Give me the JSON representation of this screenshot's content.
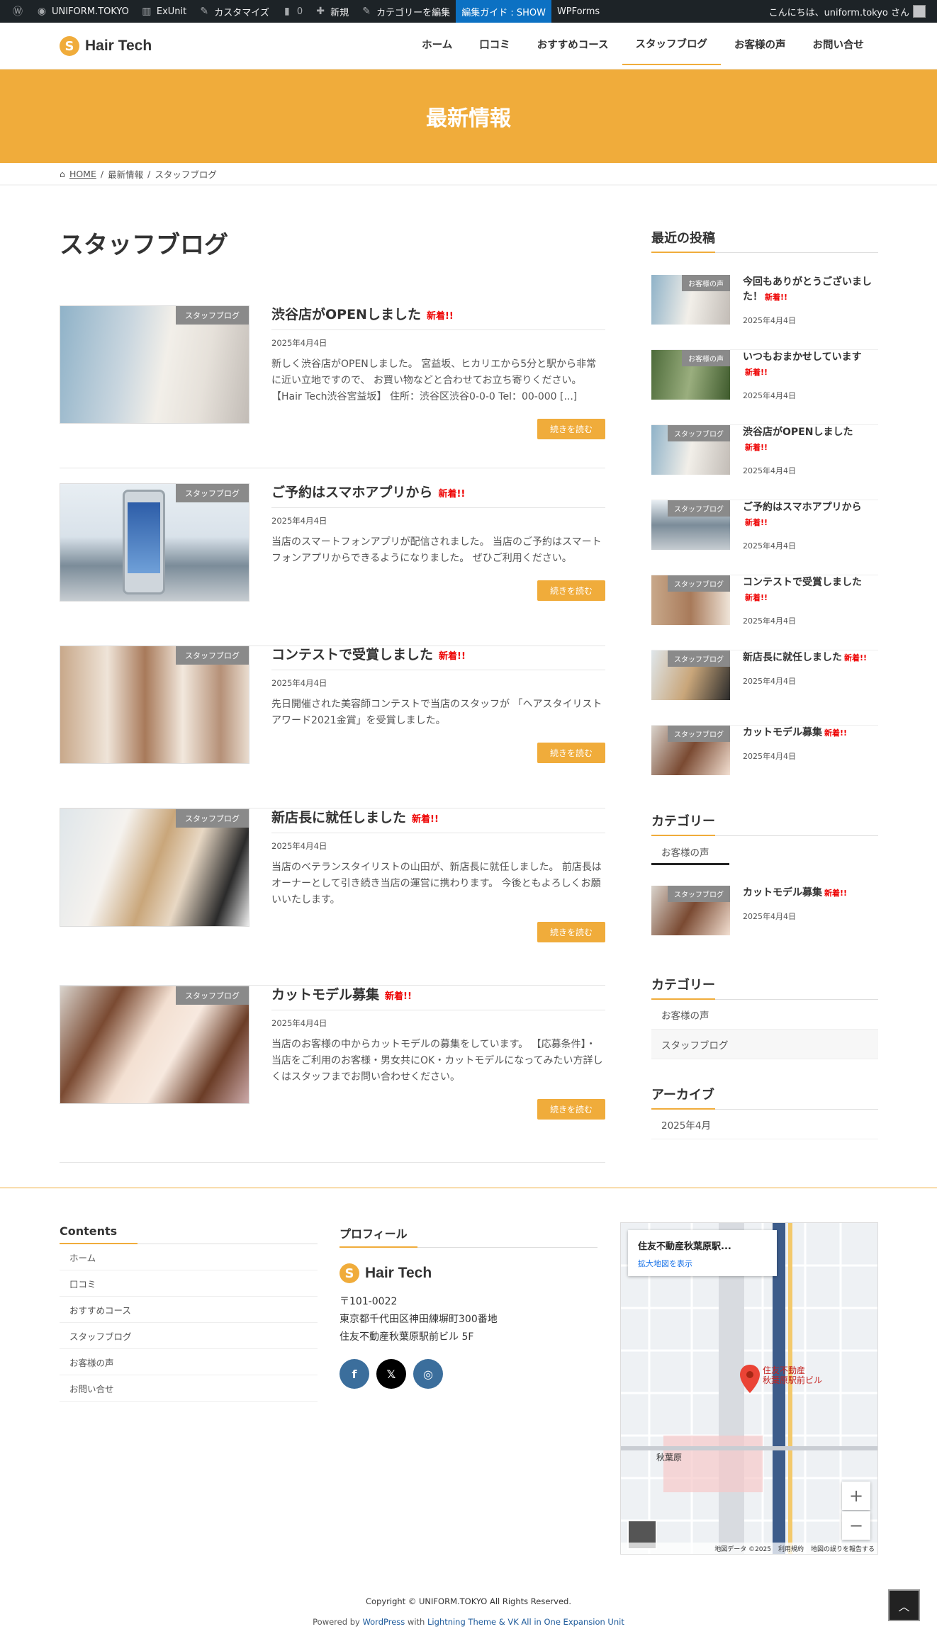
{
  "adminbar": {
    "site": "UNIFORM.TOKYO",
    "exunit": "ExUnit",
    "customize": "カスタマイズ",
    "comments": "0",
    "new": "新規",
    "edit_category": "カテゴリーを編集",
    "guide": "編集ガイド : SHOW",
    "wpforms": "WPForms",
    "greeting": "こんにちは、uniform.tokyo さん"
  },
  "logo": {
    "mark": "S",
    "text": "Hair Tech"
  },
  "nav": [
    "ホーム",
    "口コミ",
    "おすすめコース",
    "スタッフブログ",
    "お客様の声",
    "お問い合せ"
  ],
  "hero": {
    "title": "最新情報"
  },
  "breadcrumb": {
    "home": "HOME",
    "level1": "最新情報",
    "current": "スタッフブログ"
  },
  "page_title": "スタッフブログ",
  "posts": [
    {
      "tag": "スタッフブログ",
      "title": "渋谷店がOPENしました",
      "new": "新着!!",
      "date": "2025年4月4日",
      "excerpt": "新しく渋谷店がOPENしました。 宮益坂、ヒカリエから5分と駅から非常に近い立地ですので、 お買い物などと合わせてお立ち寄りください。 【Hair Tech渋谷宮益坂】 住所：渋谷区渋谷0-0-0 Tel：00-000 [...]",
      "more": "続きを読む"
    },
    {
      "tag": "スタッフブログ",
      "title": "ご予約はスマホアプリから",
      "new": "新着!!",
      "date": "2025年4月4日",
      "excerpt": "当店のスマートフォンアプリが配信されました。 当店のご予約はスマートフォンアプリからできるようになりました。 ぜひご利用ください。",
      "more": "続きを読む"
    },
    {
      "tag": "スタッフブログ",
      "title": "コンテストで受賞しました",
      "new": "新着!!",
      "date": "2025年4月4日",
      "excerpt": "先日開催された美容師コンテストで当店のスタッフが 「ヘアスタイリストアワード2021金賞」を受賞しました。",
      "more": "続きを読む"
    },
    {
      "tag": "スタッフブログ",
      "title": "新店長に就任しました",
      "new": "新着!!",
      "date": "2025年4月4日",
      "excerpt": "当店のベテランスタイリストの山田が、新店長に就任しました。 前店長はオーナーとして引き続き当店の運営に携わります。 今後ともよろしくお願いいたします。",
      "more": "続きを読む"
    },
    {
      "tag": "スタッフブログ",
      "title": "カットモデル募集",
      "new": "新着!!",
      "date": "2025年4月4日",
      "excerpt": "当店のお客様の中からカットモデルの募集をしています。 【応募条件】・当店をご利用のお客様・男女共にOK・カットモデルになってみたい方詳しくはスタッフまでお問い合わせください。",
      "more": "続きを読む"
    }
  ],
  "sidebar": {
    "recent_heading": "最近の投稿",
    "recent": [
      {
        "tag": "お客様の声",
        "title": "今回もありがとうございました！",
        "new": "新着!!",
        "date": "2025年4月4日"
      },
      {
        "tag": "お客様の声",
        "title": "いつもおまかせしています",
        "new": "新着!!",
        "date": "2025年4月4日"
      },
      {
        "tag": "スタッフブログ",
        "title": "渋谷店がOPENしました",
        "new": "新着!!",
        "date": "2025年4月4日"
      },
      {
        "tag": "スタッフブログ",
        "title": "ご予約はスマホアプリから",
        "new": "新着!!",
        "date": "2025年4月4日"
      },
      {
        "tag": "スタッフブログ",
        "title": "コンテストで受賞しました",
        "new": "新着!!",
        "date": "2025年4月4日"
      },
      {
        "tag": "スタッフブログ",
        "title": "新店長に就任しました",
        "new": "新着!!",
        "date": "2025年4月4日"
      },
      {
        "tag": "スタッフブログ",
        "title": "カットモデル募集",
        "new": "新着!!",
        "date": "2025年4月4日"
      }
    ],
    "cat1_heading": "カテゴリー",
    "cat1_item": "お客様の声",
    "cat1_post": {
      "tag": "スタッフブログ",
      "title": "カットモデル募集",
      "new": "新着!!",
      "date": "2025年4月4日"
    },
    "cat2_heading": "カテゴリー",
    "cat2_items": [
      "お客様の声",
      "スタッフブログ"
    ],
    "archive_heading": "アーカイブ",
    "archive_items": [
      "2025年4月"
    ]
  },
  "footer": {
    "contents_heading": "Contents",
    "links": [
      "ホーム",
      "口コミ",
      "おすすめコース",
      "スタッフブログ",
      "お客様の声",
      "お問い合せ"
    ],
    "profile_heading": "プロフィール",
    "profile_logo": "Hair Tech",
    "postal": "〒101-0022",
    "address1": "東京都千代田区神田練塀町300番地",
    "address2": "住友不動産秋葉原駅前ビル 5F",
    "map": {
      "place": "住友不動産秋葉原駅...",
      "enlarge": "拡大地図を表示",
      "pin_label": "住友不動産 秋葉原駅前ビル",
      "station": "秋葉原",
      "footer_data": "地図データ ©2025",
      "terms": "利用規約",
      "report": "地図の誤りを報告する"
    },
    "copyright": "Copyright © UNIFORM.TOKYO All Rights Reserved.",
    "powered_prefix": "Powered by ",
    "powered_wp": "WordPress",
    "powered_with": " with ",
    "powered_theme": "Lightning Theme & VK All in One Expansion Unit"
  },
  "colors": {
    "accent": "#f0ac3b",
    "new_badge": "#ee0000",
    "adminbar": "#1d2327",
    "facebook": "#1877f2",
    "x": "#000000",
    "instagram": "#3b6e9c"
  }
}
